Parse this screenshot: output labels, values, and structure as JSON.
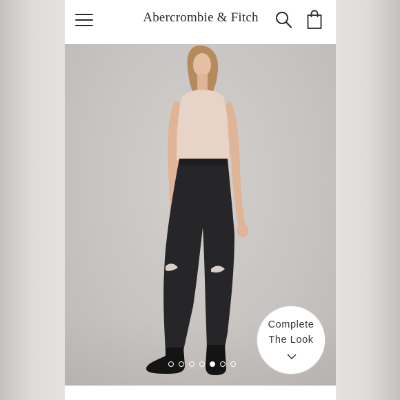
{
  "header": {
    "brand": "Abercrombie & Fitch",
    "menu_icon": "hamburger-menu-icon",
    "search_icon": "search-icon",
    "bag_icon": "shopping-bag-icon"
  },
  "product_image": {
    "carousel": {
      "count": 7,
      "active_index": 4
    },
    "complete_look": {
      "line1": "Complete",
      "line2": "The Look",
      "icon": "chevron-down-icon"
    }
  },
  "colors": {
    "backdrop": "#c8c4c2",
    "text": "#2b2b2b",
    "denim": "#252526",
    "top": "#e6d3c5"
  }
}
